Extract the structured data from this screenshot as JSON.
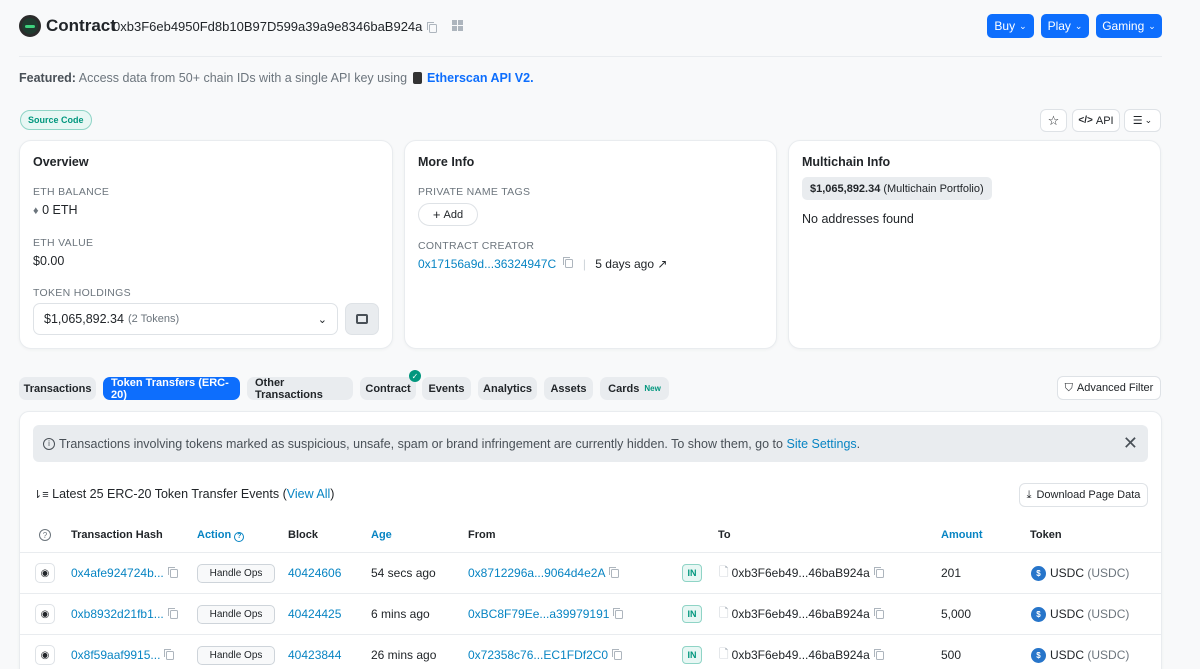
{
  "header": {
    "title": "Contract",
    "address": "0xb3F6eb4950Fd8b10B97D599a39a9e8346baB924a",
    "buttons": {
      "buy": "Buy",
      "play": "Play",
      "gaming": "Gaming"
    }
  },
  "featured": {
    "label": "Featured:",
    "text": "Access data from 50+ chain IDs with a single API key using",
    "link": "Etherscan API V2."
  },
  "source_badge": "Source Code",
  "toolbar": {
    "api": "API"
  },
  "overview": {
    "title": "Overview",
    "eth_balance_label": "ETH BALANCE",
    "eth_balance": "0 ETH",
    "eth_value_label": "ETH VALUE",
    "eth_value": "$0.00",
    "token_holdings_label": "TOKEN HOLDINGS",
    "token_holdings_value": "$1,065,892.34",
    "token_holdings_count": "(2 Tokens)"
  },
  "more_info": {
    "title": "More Info",
    "private_tags_label": "PRIVATE NAME TAGS",
    "add_label": "Add",
    "creator_label": "CONTRACT CREATOR",
    "creator_address": "0x17156a9d...36324947C",
    "creator_age": "5 days ago"
  },
  "multichain": {
    "title": "Multichain Info",
    "portfolio_value": "$1,065,892.34",
    "portfolio_label": "(Multichain Portfolio)",
    "empty_text": "No addresses found"
  },
  "tabs": {
    "transactions": "Transactions",
    "token_transfers": "Token Transfers (ERC-20)",
    "other": "Other Transactions",
    "contract": "Contract",
    "events": "Events",
    "analytics": "Analytics",
    "assets": "Assets",
    "cards": "Cards",
    "cards_badge": "New",
    "advanced_filter": "Advanced Filter"
  },
  "notice": {
    "text": "Transactions involving tokens marked as suspicious, unsafe, spam or brand infringement are currently hidden. To show them, go to",
    "link": "Site Settings",
    "end": "."
  },
  "table": {
    "summary": "Latest 25 ERC-20 Token Transfer Events (",
    "summary_link": "View All",
    "summary_end": ")",
    "download": "Download Page Data",
    "columns": {
      "hash": "Transaction Hash",
      "action": "Action",
      "block": "Block",
      "age": "Age",
      "from": "From",
      "to": "To",
      "amount": "Amount",
      "token": "Token"
    },
    "rows": [
      {
        "hash": "0x4afe924724b...",
        "action": "Handle Ops",
        "block": "40424606",
        "age": "54 secs ago",
        "from": "0x8712296a...9064d4e2A",
        "dir": "IN",
        "to": "0xb3F6eb49...46baB924a",
        "amount": "201",
        "token": "USDC",
        "symbol": "(USDC)"
      },
      {
        "hash": "0xb8932d21fb1...",
        "action": "Handle Ops",
        "block": "40424425",
        "age": "6 mins ago",
        "from": "0xBC8F79Ee...a39979191",
        "dir": "IN",
        "to": "0xb3F6eb49...46baB924a",
        "amount": "5,000",
        "token": "USDC",
        "symbol": "(USDC)"
      },
      {
        "hash": "0x8f59aaf9915...",
        "action": "Handle Ops",
        "block": "40423844",
        "age": "26 mins ago",
        "from": "0x72358c76...EC1FDf2C0",
        "dir": "IN",
        "to": "0xb3F6eb49...46baB924a",
        "amount": "500",
        "token": "USDC",
        "symbol": "(USDC)"
      }
    ]
  }
}
